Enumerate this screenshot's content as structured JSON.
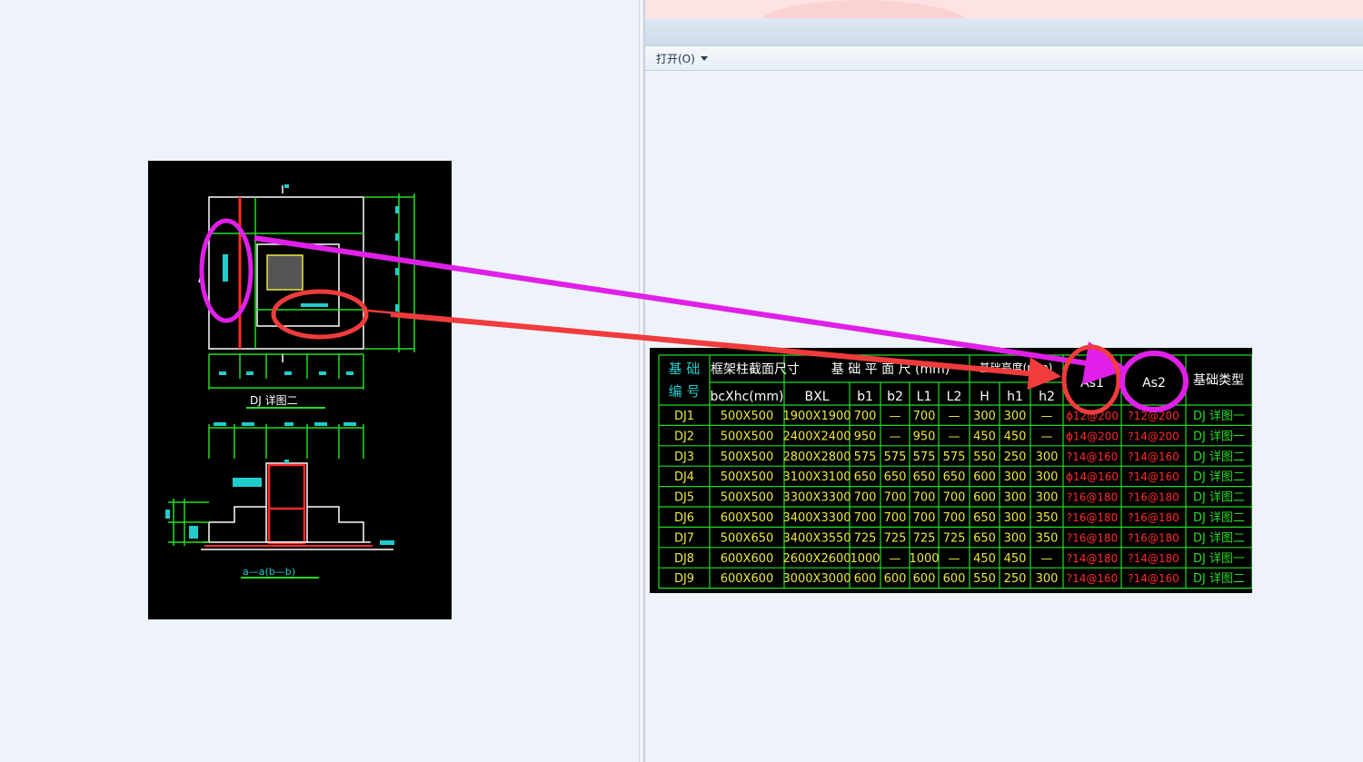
{
  "toolbar": {
    "open_label": "打开(O)"
  },
  "drawing": {
    "detail_title": "DJ 详图二",
    "section_title": "a—a(b—b)"
  },
  "table": {
    "headers": {
      "foundation_id_1": "基  础",
      "foundation_id_2": "编  号",
      "column_size": "框架柱截面尺寸",
      "plan_size": "基 础 平 面 尺 (mm)",
      "height": "基础高度(mm)",
      "as1": "As1",
      "as2": "As2",
      "type": "基础类型"
    },
    "sub_headers": [
      "bcXhc(mm)",
      "BXL",
      "b1",
      "b2",
      "L1",
      "L2",
      "H",
      "h1",
      "h2"
    ],
    "rows": [
      [
        "DJ1",
        "500X500",
        "1900X1900",
        "700",
        "—",
        "700",
        "—",
        "300",
        "300",
        "—",
        "ɸ12@200",
        "?12@200",
        "DJ  详图一"
      ],
      [
        "DJ2",
        "500X500",
        "2400X2400",
        "950",
        "—",
        "950",
        "—",
        "450",
        "450",
        "—",
        "ɸ14@200",
        "?14@200",
        "DJ  详图一"
      ],
      [
        "DJ3",
        "500X500",
        "2800X2800",
        "575",
        "575",
        "575",
        "575",
        "550",
        "250",
        "300",
        "?14@160",
        "?14@160",
        "DJ  详图二"
      ],
      [
        "DJ4",
        "500X500",
        "3100X3100",
        "650",
        "650",
        "650",
        "650",
        "600",
        "300",
        "300",
        "ɸ14@160",
        "?14@160",
        "DJ  详图二"
      ],
      [
        "DJ5",
        "500X500",
        "3300X3300",
        "700",
        "700",
        "700",
        "700",
        "600",
        "300",
        "300",
        "?16@180",
        "?16@180",
        "DJ  详图二"
      ],
      [
        "DJ6",
        "600X500",
        "3400X3300",
        "700",
        "700",
        "700",
        "700",
        "650",
        "300",
        "350",
        "?16@180",
        "?16@180",
        "DJ  详图二"
      ],
      [
        "DJ7",
        "500X650",
        "3400X3550",
        "725",
        "725",
        "725",
        "725",
        "650",
        "300",
        "350",
        "?16@180",
        "?16@180",
        "DJ  详图二"
      ],
      [
        "DJ8",
        "600X600",
        "2600X2600",
        "1000",
        "—",
        "1000",
        "—",
        "450",
        "450",
        "—",
        "?14@180",
        "?14@180",
        "DJ  详图一"
      ],
      [
        "DJ9",
        "600X600",
        "3000X3000",
        "600",
        "600",
        "600",
        "600",
        "550",
        "250",
        "300",
        "?14@160",
        "?14@160",
        "DJ  详图二"
      ]
    ]
  },
  "colors": {
    "cad_background": "#000000",
    "cad_green": "#22dd22",
    "cad_cyan": "#22cccc",
    "cad_yellow": "#e8e840",
    "cad_red": "#ff2a2a",
    "cad_white": "#ffffff",
    "annotation_red": "#f03c3c",
    "annotation_magenta": "#e020e8"
  },
  "icons": {
    "dropdown": "chevron-down-icon"
  }
}
